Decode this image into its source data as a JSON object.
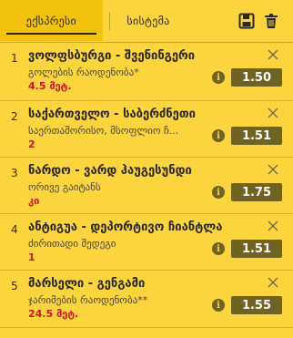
{
  "tabs": {
    "express": "ექსპრესი",
    "system": "სისტემა"
  },
  "toolbar": {
    "save_icon": "floppy-disk-icon",
    "trash_icon": "trash-icon"
  },
  "colors": {
    "background": "#fbd43e",
    "active_tab": "#f3c20e",
    "odd_button": "#6f6223",
    "stake_text": "#d1122a"
  },
  "bets": [
    {
      "index": "1",
      "match": "ვოლფსბურგი - შვენინგერი",
      "market": "გოლების რაოდენობა*",
      "selection": "4.5 მეტ.",
      "odd": "1.50"
    },
    {
      "index": "2",
      "match": "საქართველო - საბერძნეთი",
      "market": "საერთაშორისო, მსოფლიო ჩ...",
      "selection": "2",
      "odd": "1.51"
    },
    {
      "index": "3",
      "match": "ნარდო - ვარდ ჰაუგესუნდი",
      "market": "ორივე გაიტანს",
      "selection": "კი",
      "odd": "1.75"
    },
    {
      "index": "4",
      "match": "ანტიგუა - დეპორტივო ჩიანტლა",
      "market": "ძირითადი შედეგი",
      "selection": "1",
      "odd": "1.51"
    },
    {
      "index": "5",
      "match": "მარსელი - გენგამი",
      "market": "ჯარიმების რაოდენობა**",
      "selection": "24.5 მეტ.",
      "odd": "1.55"
    }
  ]
}
